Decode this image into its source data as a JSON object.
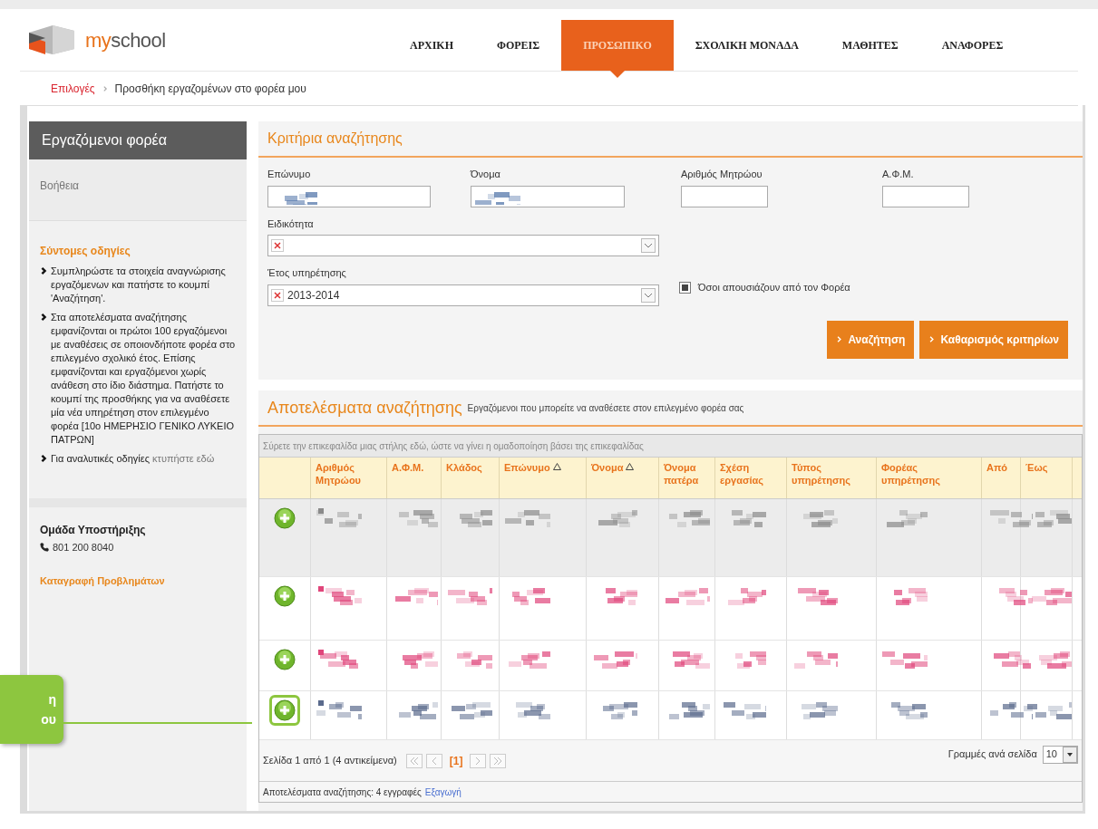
{
  "logo": {
    "prefix": "my",
    "suffix": "school"
  },
  "nav": [
    {
      "label": "ΑΡΧΙΚΗ",
      "selected": false
    },
    {
      "label": "ΦΟΡΕΙΣ",
      "selected": false
    },
    {
      "label": "ΠΡΟΣΩΠΙΚΟ",
      "selected": true
    },
    {
      "label": "ΣΧΟΛΙΚΗ ΜΟΝΑΔΑ",
      "selected": false
    },
    {
      "label": "ΜΑΘΗΤΕΣ",
      "selected": false
    },
    {
      "label": "ΑΝΑΦΟΡΕΣ",
      "selected": false
    }
  ],
  "breadcrumb": {
    "link": "Επιλογές",
    "current": "Προσθήκη εργαζομένων στο φορέα μου"
  },
  "sidebar": {
    "title": "Εργαζόμενοι φορέα",
    "help": "Βοήθεια",
    "guide_title": "Σύντομες οδηγίες",
    "tips": [
      {
        "text": "Συμπληρώστε τα στοιχεία αναγνώρισης εργαζόμενων και πατήστε το κουμπί 'Αναζήτηση'."
      },
      {
        "text": "Στα αποτελέσματα αναζήτησης εμφανίζονται οι πρώτοι 100 εργαζόμενοι με αναθέσεις σε οποιονδήποτε φορέα στο επιλεγμένο σχολικό έτος. Επίσης εμφανίζονται και εργαζόμενοι χωρίς ανάθεση στο ίδιο διάστημα. Πατήστε το κουμπί της προσθήκης για να αναθέσετε μία νέα υπηρέτηση στον επιλεγμένο φορέα [10ο ΗΜΕΡΗΣΙΟ ΓΕΝΙΚΟ ΛΥΚΕΙΟ ΠΑΤΡΩΝ]"
      },
      {
        "text": "Για αναλυτικές οδηγίες",
        "link": "κτυπήστε εδώ"
      }
    ],
    "support_title": "Ομάδα Υποστήριξης",
    "phone": "801 200 8040",
    "report_link": "Καταγραφή Προβλημάτων"
  },
  "search": {
    "title": "Κριτήρια αναζήτησης",
    "fields": [
      {
        "label": "Επώνυμο",
        "blurred": true
      },
      {
        "label": "Όνομα",
        "blurred": true
      },
      {
        "label": "Αριθμός Μητρώου",
        "blurred": false
      },
      {
        "label": "Α.Φ.Μ.",
        "blurred": false
      }
    ],
    "specialty": {
      "label": "Ειδικότητα"
    },
    "year": {
      "label": "Έτος υπηρέτησης",
      "value": "2013-2014"
    },
    "absent": {
      "label": "Όσοι απουσιάζουν από τον Φορέα",
      "checked": true
    },
    "buttons": [
      "Αναζήτηση",
      "Καθαρισμός κριτηρίων"
    ]
  },
  "results": {
    "title": "Αποτελέσματα αναζήτησης",
    "subtitle": "Εργαζόμενοι που μπορείτε να αναθέσετε στον επιλεγμένο φορέα σας",
    "group_hint": "Σύρετε την επικεφαλίδα μιας στήλης εδώ, ώστε να γίνει η ομαδοποίηση βάσει της επικεφαλίδας",
    "columns": [
      {
        "label": "Αριθμός Μητρώου",
        "sorted": false
      },
      {
        "label": "Α.Φ.Μ.",
        "sorted": false
      },
      {
        "label": "Κλάδος",
        "sorted": false
      },
      {
        "label": "Επώνυμο",
        "sorted": true
      },
      {
        "label": "Όνομα",
        "sorted": true
      },
      {
        "label": "Όνομα πατέρα",
        "sorted": false
      },
      {
        "label": "Σχέση εργασίας",
        "sorted": false
      },
      {
        "label": "Τύπος υπηρέτησης",
        "sorted": false
      },
      {
        "label": "Φορέας υπηρέτησης",
        "sorted": false
      },
      {
        "label": "Από",
        "sorted": false
      },
      {
        "label": "Έως",
        "sorted": false
      }
    ],
    "rows": [
      {
        "selected": true,
        "color": "#8a8a8a",
        "highlighted": false
      },
      {
        "selected": false,
        "color": "#e0457a",
        "highlighted": false
      },
      {
        "selected": false,
        "color": "#e0457a",
        "highlighted": false
      },
      {
        "selected": false,
        "color": "#5a6a8c",
        "highlighted": true
      }
    ],
    "pager": {
      "summary": "Σελίδα 1 από 1 (4 αντικείμενα)",
      "page": "[1]",
      "rows_label": "Γραμμές ανά σελίδα",
      "rows_value": "10"
    },
    "footer": {
      "text": "Αποτελέσματα αναζήτησης: 4 εγγραφές",
      "link": "Εξαγωγή"
    }
  },
  "callout": {
    "lines": [
      "η",
      "ου"
    ]
  }
}
